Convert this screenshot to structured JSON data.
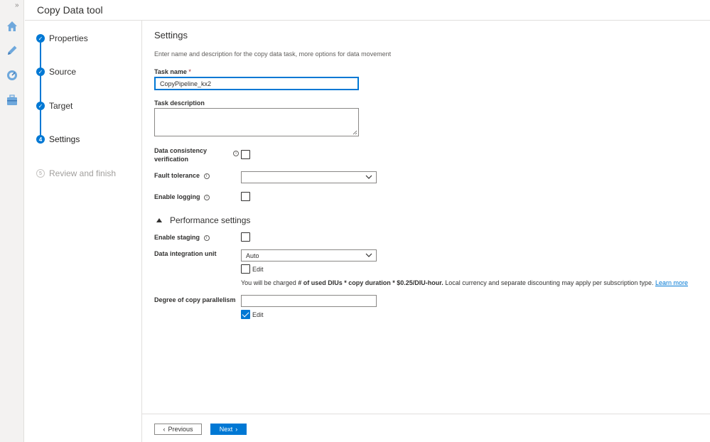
{
  "app": {
    "title": "Copy Data tool",
    "expand_glyph": "»"
  },
  "rail": {
    "icons": [
      "home-icon",
      "pencil-icon",
      "monitor-icon",
      "toolbox-icon"
    ]
  },
  "steps": [
    {
      "label": "Properties",
      "marker": "✓",
      "state": "done"
    },
    {
      "label": "Source",
      "marker": "✓",
      "state": "done"
    },
    {
      "label": "Target",
      "marker": "✓",
      "state": "done"
    },
    {
      "label": "Settings",
      "marker": "4",
      "state": "active"
    },
    {
      "label": "Review and finish",
      "marker": "5",
      "state": "pending"
    }
  ],
  "settings": {
    "heading": "Settings",
    "description": "Enter name and description for the copy data task, more options for data movement",
    "task_name_label": "Task name",
    "required_mark": "*",
    "task_name_value": "CopyPipeline_kx2",
    "task_description_label": "Task description",
    "task_description_value": "",
    "consistency_label_line1": "Data consistency",
    "consistency_label_line2": "verification",
    "consistency_checked": false,
    "fault_tolerance_label": "Fault tolerance",
    "fault_tolerance_value": "",
    "enable_logging_label": "Enable logging",
    "enable_logging_checked": false,
    "info_glyph": "i"
  },
  "performance": {
    "heading": "Performance settings",
    "enable_staging_label": "Enable staging",
    "enable_staging_checked": false,
    "diu_label": "Data integration unit",
    "diu_value": "Auto",
    "diu_edit_label": "Edit",
    "diu_edit_checked": false,
    "charge_prefix": "You will be charged ",
    "charge_bold": "# of used DIUs * copy duration * $0.25/DIU-hour.",
    "charge_suffix": " Local currency and separate discounting may apply per subscription type. ",
    "learn_more": "Learn more",
    "parallelism_label": "Degree of copy parallelism",
    "parallelism_value": "",
    "parallelism_edit_label": "Edit",
    "parallelism_edit_checked": true
  },
  "footer": {
    "previous_label": "Previous",
    "next_label": "Next",
    "prev_glyph": "‹",
    "next_glyph": "›"
  },
  "colors": {
    "accent": "#0078d4",
    "border": "#8a8886",
    "required": "#a4262c"
  }
}
